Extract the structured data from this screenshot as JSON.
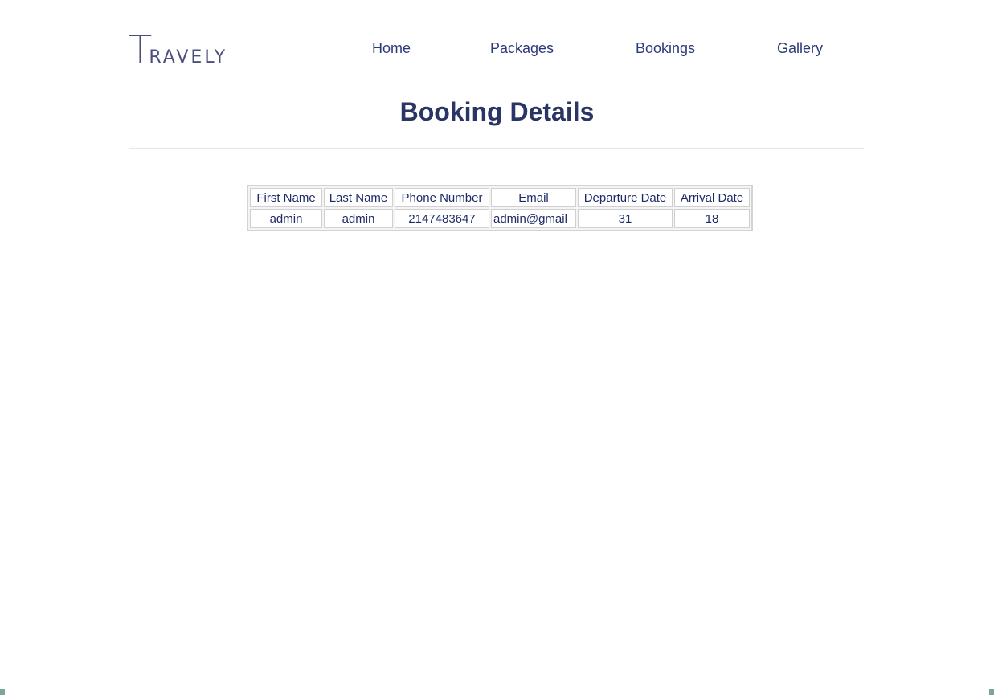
{
  "brand": {
    "logo_initial": "T",
    "logo_rest": "RAVELY"
  },
  "nav": {
    "items": [
      "Home",
      "Packages",
      "Bookings",
      "Gallery"
    ]
  },
  "page": {
    "title": "Booking Details"
  },
  "table": {
    "headers": [
      "First Name",
      "Last Name",
      "Phone Number",
      "Email",
      "Departure Date",
      "Arrival Date"
    ],
    "rows": [
      [
        "admin",
        "admin",
        "2147483647",
        "admin@gmail",
        "31",
        "18"
      ]
    ]
  }
}
